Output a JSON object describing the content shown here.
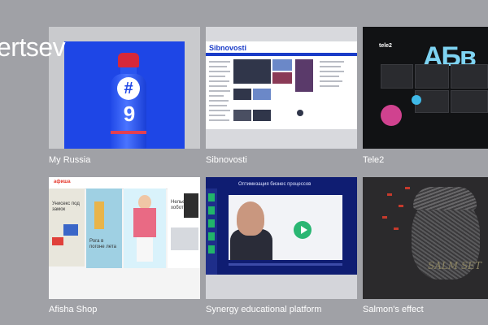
{
  "brand": {
    "text": "ertsev"
  },
  "projects": [
    {
      "title": "My Russia"
    },
    {
      "title": "Sibnovosti"
    },
    {
      "title": "Tele2"
    },
    {
      "title": "Afisha Shop"
    },
    {
      "title": "Synergy educational platform"
    },
    {
      "title": "Salmon's effect"
    }
  ],
  "thumbs": {
    "sibnovosti_logo": "Sibnovosti",
    "tele2_letters": "АБв",
    "tele2_logo": "tele2",
    "afisha_logo": "афиша",
    "synergy_header": "Оптимизация бизнес процессов",
    "salmon_signature": "SALM SET"
  },
  "colors": {
    "background": "#a0a1a6",
    "caption": "#ffffff",
    "my_russia_blue": "#1e46e6",
    "synergy_navy": "#0f1d72"
  }
}
